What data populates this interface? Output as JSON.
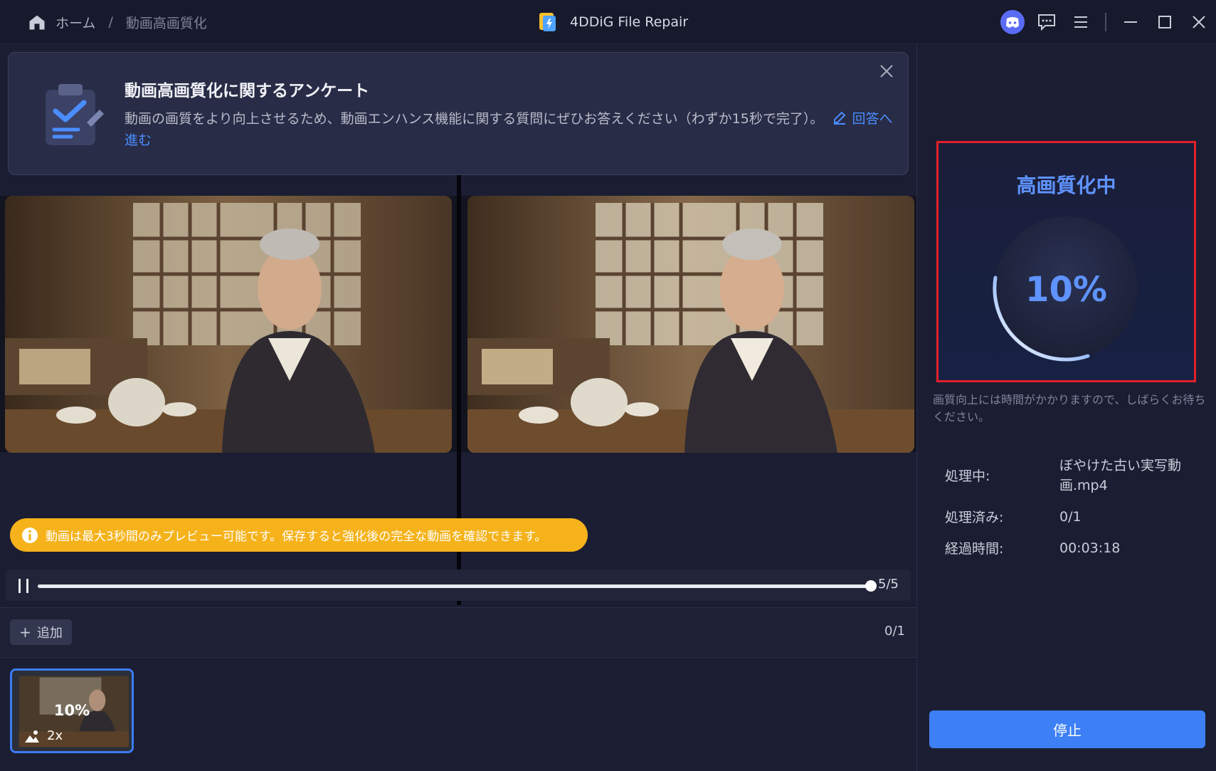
{
  "header": {
    "breadcrumb_home": "ホーム",
    "breadcrumb_sep": "/",
    "breadcrumb_current": "動画高画質化",
    "app_title": "4DDiG File Repair"
  },
  "survey": {
    "title": "動画高画質化に関するアンケート",
    "description": "動画の画質をより向上させるため、動画エンハンス機能に関する質問にぜひお答えください（わずか15秒で完了）。",
    "link_label": "回答へ進む"
  },
  "notice": {
    "text": "動画は最大3秒間のみプレビュー可能です。保存すると強化後の完全な動画を確認できます。"
  },
  "player": {
    "progress": 1.0,
    "page": "5/5"
  },
  "list": {
    "add_label": "追加",
    "count": "0/1",
    "thumb_progress": "10%",
    "thumb_scale": "2x"
  },
  "progress_panel": {
    "title": "高画質化中",
    "percent": "10%",
    "percent_value": 0.1,
    "hint": "画質向上には時間がかかりますので、しばらくお待ちください。"
  },
  "status": {
    "processing_label": "処理中:",
    "processing_value": "ぼやけた古い実写動画.mp4",
    "done_label": "処理済み:",
    "done_value": "0/1",
    "elapsed_label": "経過時間:",
    "elapsed_value": "00:03:18"
  },
  "stop_label": "停止",
  "colors": {
    "accent": "#3d80f5",
    "highlight_border": "#e2202a",
    "notice_bg": "#f5b21a",
    "progress_text": "#5f93ff"
  },
  "icons": [
    "home-icon",
    "app-logo-icon",
    "discord-icon",
    "chat-icon",
    "menu-icon",
    "minimize-icon",
    "maximize-icon",
    "close-icon",
    "clipboard-icon",
    "edit-icon",
    "info-icon",
    "pause-icon",
    "plus-icon",
    "image-icon"
  ]
}
